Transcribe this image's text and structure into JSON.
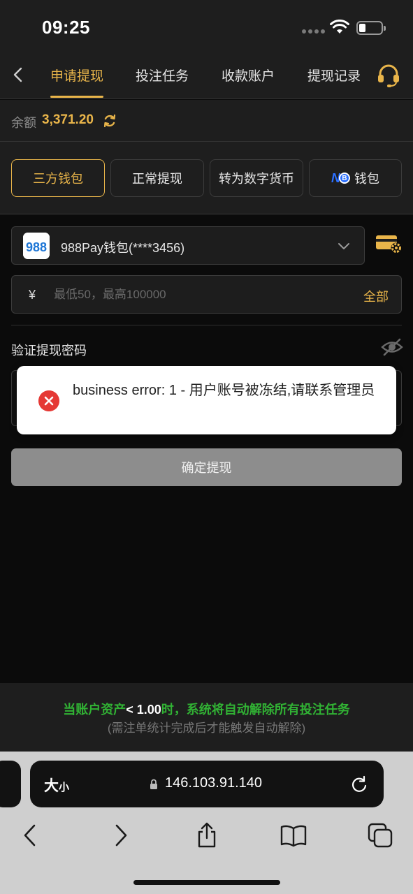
{
  "status_bar": {
    "time": "09:25"
  },
  "nav": {
    "tabs": [
      {
        "label": "申请提现",
        "active": true
      },
      {
        "label": "投注任务"
      },
      {
        "label": "收款账户"
      },
      {
        "label": "提现记录"
      }
    ]
  },
  "balance": {
    "label": "余额",
    "value": "3,371.20"
  },
  "wallet_types": [
    {
      "label": "三方钱包",
      "selected": true
    },
    {
      "label": "正常提现"
    },
    {
      "label": "转为数字货币"
    },
    {
      "label": "钱包",
      "logo_text": "N",
      "logo_badge": "B"
    }
  ],
  "wallet_select": {
    "name": "988Pay钱包(****3456)",
    "logo_text": "988"
  },
  "amount": {
    "currency": "¥",
    "placeholder": "最低50，最高100000",
    "all_label": "全部"
  },
  "password": {
    "label": "验证提现密码"
  },
  "submit": {
    "label": "确定提现"
  },
  "toast": {
    "message": "business error: 1 - 用户账号被冻结,请联系管理员"
  },
  "notice": {
    "prefix": "当账户资产",
    "threshold": "< 1.00",
    "suffix": "时，系统将自动解除所有投注任务",
    "sub": "(需注单统计完成后才能触发自动解除)"
  },
  "browser": {
    "text_size_big": "大",
    "text_size_small": "小",
    "url": "146.103.91.140"
  },
  "colors": {
    "accent": "#e9b54a",
    "notice_green": "#31b234",
    "error_red": "#e53935"
  }
}
